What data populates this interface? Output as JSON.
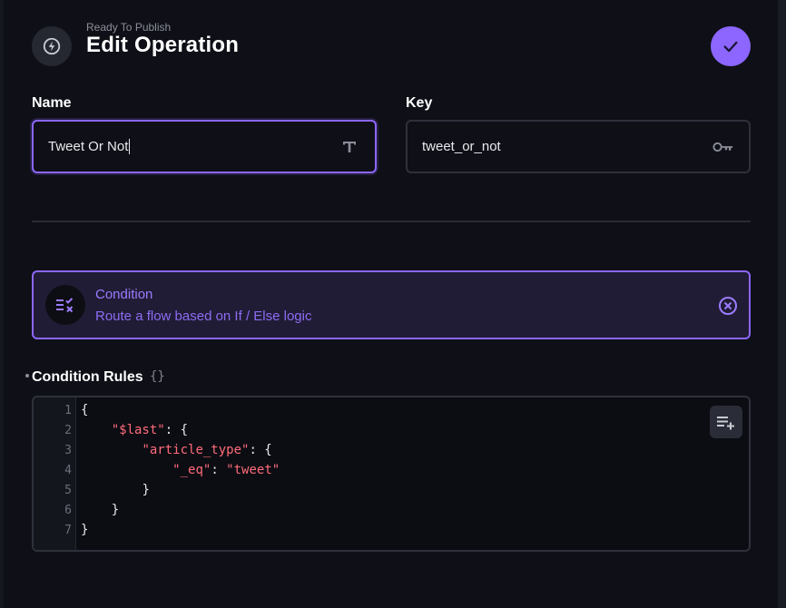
{
  "header": {
    "subtitle": "Ready To Publish",
    "title": "Edit Operation",
    "icon": "bolt-circle-icon",
    "save_icon": "check-icon"
  },
  "fields": {
    "name_label": "Name",
    "name_value": "Tweet Or Not",
    "name_icon": "text-type-icon",
    "key_label": "Key",
    "key_value": "tweet_or_not",
    "key_icon": "key-icon"
  },
  "condition": {
    "title": "Condition",
    "description": "Route a flow based on If / Else logic",
    "icon": "rule-check-icon",
    "remove_icon": "close-circle-icon"
  },
  "rules": {
    "label": "Condition Rules",
    "braces": "{}",
    "line_numbers": [
      "1",
      "2",
      "3",
      "4",
      "5",
      "6",
      "7"
    ],
    "lines": {
      "l1_open": "{",
      "l2_key": "\"$last\"",
      "l2_rest": ": {",
      "l3_key": "\"article_type\"",
      "l3_rest": ": {",
      "l4_key": "\"_eq\"",
      "l4_colon": ": ",
      "l4_value": "\"tweet\"",
      "l5_close": "}",
      "l6_close": "}",
      "l7_close": "}"
    },
    "format_icon": "playlist-add-icon"
  },
  "colors": {
    "accent": "#8c66ff",
    "background": "#0f1017",
    "card_bg": "#211c35",
    "string": "#ff6b7a"
  }
}
